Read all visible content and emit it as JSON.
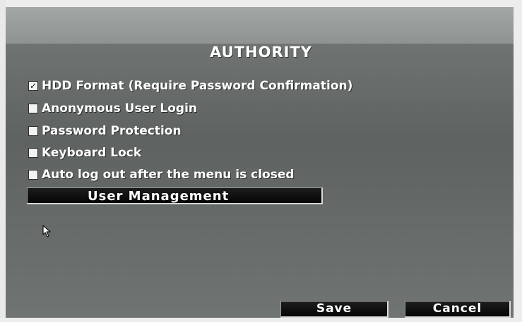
{
  "dialog": {
    "title": "AUTHORITY"
  },
  "options": [
    {
      "label": "HDD Format (Require Password Confirmation)",
      "checked": true
    },
    {
      "label": "Anonymous User Login",
      "checked": false
    },
    {
      "label": "Password Protection",
      "checked": false
    },
    {
      "label": "Keyboard Lock",
      "checked": false
    },
    {
      "label": "Auto log out after the menu is closed",
      "checked": false
    }
  ],
  "buttons": {
    "user_management": "User Management",
    "save": "Save",
    "cancel": "Cancel"
  },
  "icons": {
    "check": "check-icon",
    "cursor": "mouse-pointer-icon"
  },
  "colors": {
    "panel": "#6a6e6c",
    "text": "#ffffff",
    "button": "#0f0f0f"
  }
}
